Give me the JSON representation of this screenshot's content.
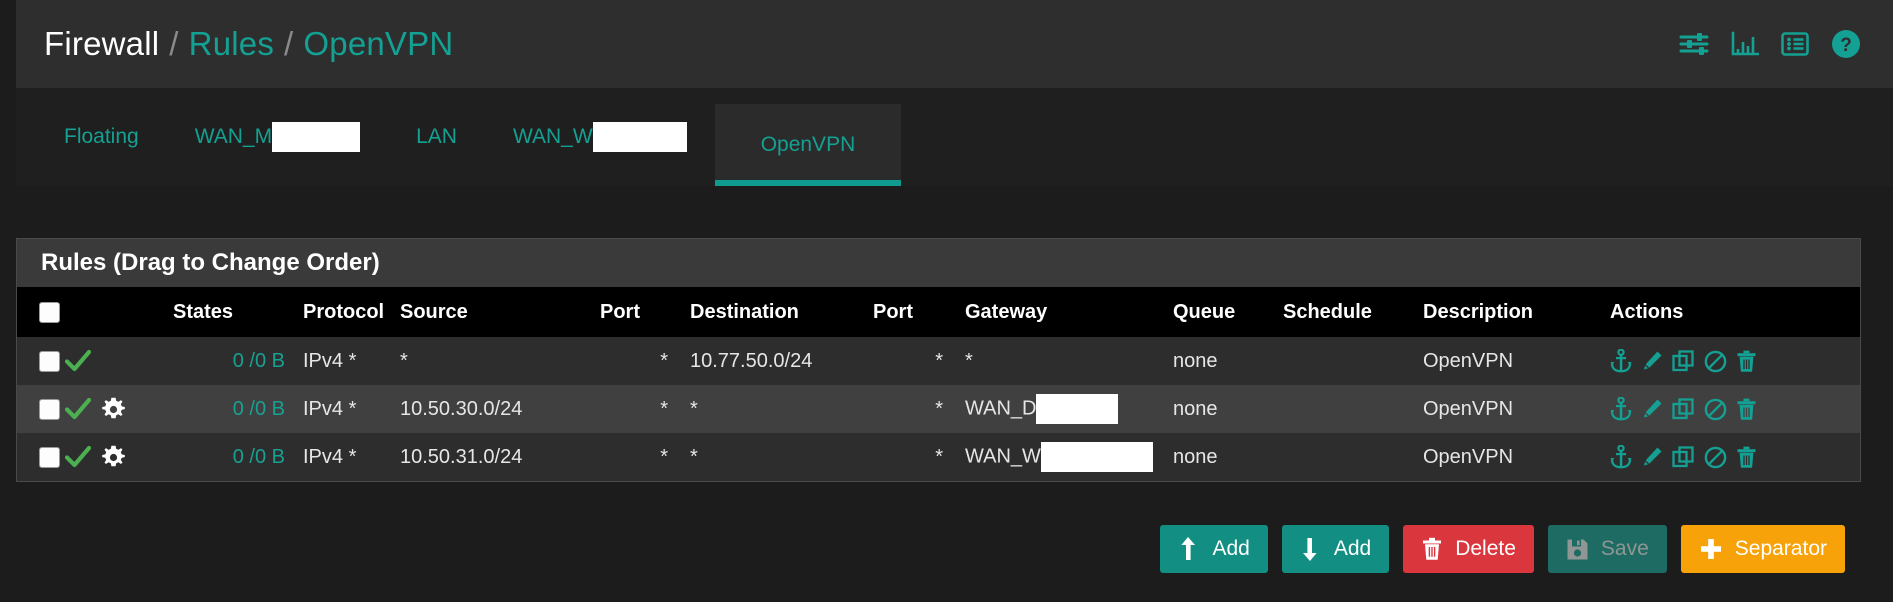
{
  "breadcrumb": {
    "root": "Firewall",
    "sep": "/",
    "section": "Rules",
    "page": "OpenVPN"
  },
  "header_icons": [
    {
      "name": "sliders-icon",
      "label": "Advanced Filter"
    },
    {
      "name": "bar-chart-icon",
      "label": "Statistics"
    },
    {
      "name": "list-icon",
      "label": "Log"
    },
    {
      "name": "help-icon",
      "label": "Help"
    }
  ],
  "tabs": [
    {
      "label": "Floating",
      "redacted": false,
      "redact_width": 0,
      "active": false
    },
    {
      "label": "WAN_M",
      "redacted": true,
      "redact_width": 88,
      "active": false
    },
    {
      "label": "LAN",
      "redacted": false,
      "redact_width": 0,
      "active": false
    },
    {
      "label": "WAN_W",
      "redacted": true,
      "redact_width": 94,
      "active": false
    },
    {
      "label": "OpenVPN",
      "redacted": false,
      "redact_width": 0,
      "active": true
    }
  ],
  "panel": {
    "title": "Rules (Drag to Change Order)",
    "columns": [
      "",
      "",
      "States",
      "Protocol",
      "Source",
      "Port",
      "Destination",
      "Port",
      "Gateway",
      "Queue",
      "Schedule",
      "Description",
      "Actions"
    ]
  },
  "rows": [
    {
      "checked": false,
      "status": "pass-check",
      "advanced": false,
      "states": "0 /0 B",
      "protocol": "IPv4 *",
      "source": "*",
      "source_port": "*",
      "destination": "10.77.50.0/24",
      "dest_port": "*",
      "gateway": "*",
      "gateway_redacted": false,
      "gateway_redact_width": 0,
      "queue": "none",
      "schedule": "",
      "description": "OpenVPN",
      "actions": [
        "anchor-icon",
        "edit-pencil-icon",
        "copy-icon",
        "disable-ban-icon",
        "delete-trash-icon"
      ]
    },
    {
      "checked": false,
      "status": "pass-check",
      "advanced": true,
      "states": "0 /0 B",
      "protocol": "IPv4 *",
      "source": "10.50.30.0/24",
      "source_port": "*",
      "destination": "*",
      "dest_port": "*",
      "gateway": "WAN_D",
      "gateway_redacted": true,
      "gateway_redact_width": 82,
      "queue": "none",
      "schedule": "",
      "description": "OpenVPN",
      "actions": [
        "anchor-icon",
        "edit-pencil-icon",
        "copy-icon",
        "disable-ban-icon",
        "delete-trash-icon"
      ]
    },
    {
      "checked": false,
      "status": "pass-check",
      "advanced": true,
      "states": "0 /0 B",
      "protocol": "IPv4 *",
      "source": "10.50.31.0/24",
      "source_port": "*",
      "destination": "*",
      "dest_port": "*",
      "gateway": "WAN_W",
      "gateway_redacted": true,
      "gateway_redact_width": 112,
      "queue": "none",
      "schedule": "",
      "description": "OpenVPN",
      "actions": [
        "anchor-icon",
        "edit-pencil-icon",
        "copy-icon",
        "disable-ban-icon",
        "delete-trash-icon"
      ]
    }
  ],
  "footer_buttons": [
    {
      "label": "Add",
      "icon": "arrow-up-icon",
      "style": "teal"
    },
    {
      "label": "Add",
      "icon": "arrow-down-icon",
      "style": "teal"
    },
    {
      "label": "Delete",
      "icon": "trash-icon",
      "style": "red"
    },
    {
      "label": "Save",
      "icon": "save-floppy-icon",
      "style": "save"
    },
    {
      "label": "Separator",
      "icon": "plus-icon",
      "style": "orange"
    }
  ],
  "colors": {
    "accent_teal": "#14a092",
    "page_bg": "#1c1c1c",
    "panel_bg": "#2e2e2e",
    "row_odd": "#2d2d2d",
    "row_even": "#404040",
    "header_row": "#000000",
    "pass_green": "#4caf50",
    "danger_red": "#d9363e",
    "separator_orange": "#f7a208",
    "redaction_white": "#ffffff"
  }
}
